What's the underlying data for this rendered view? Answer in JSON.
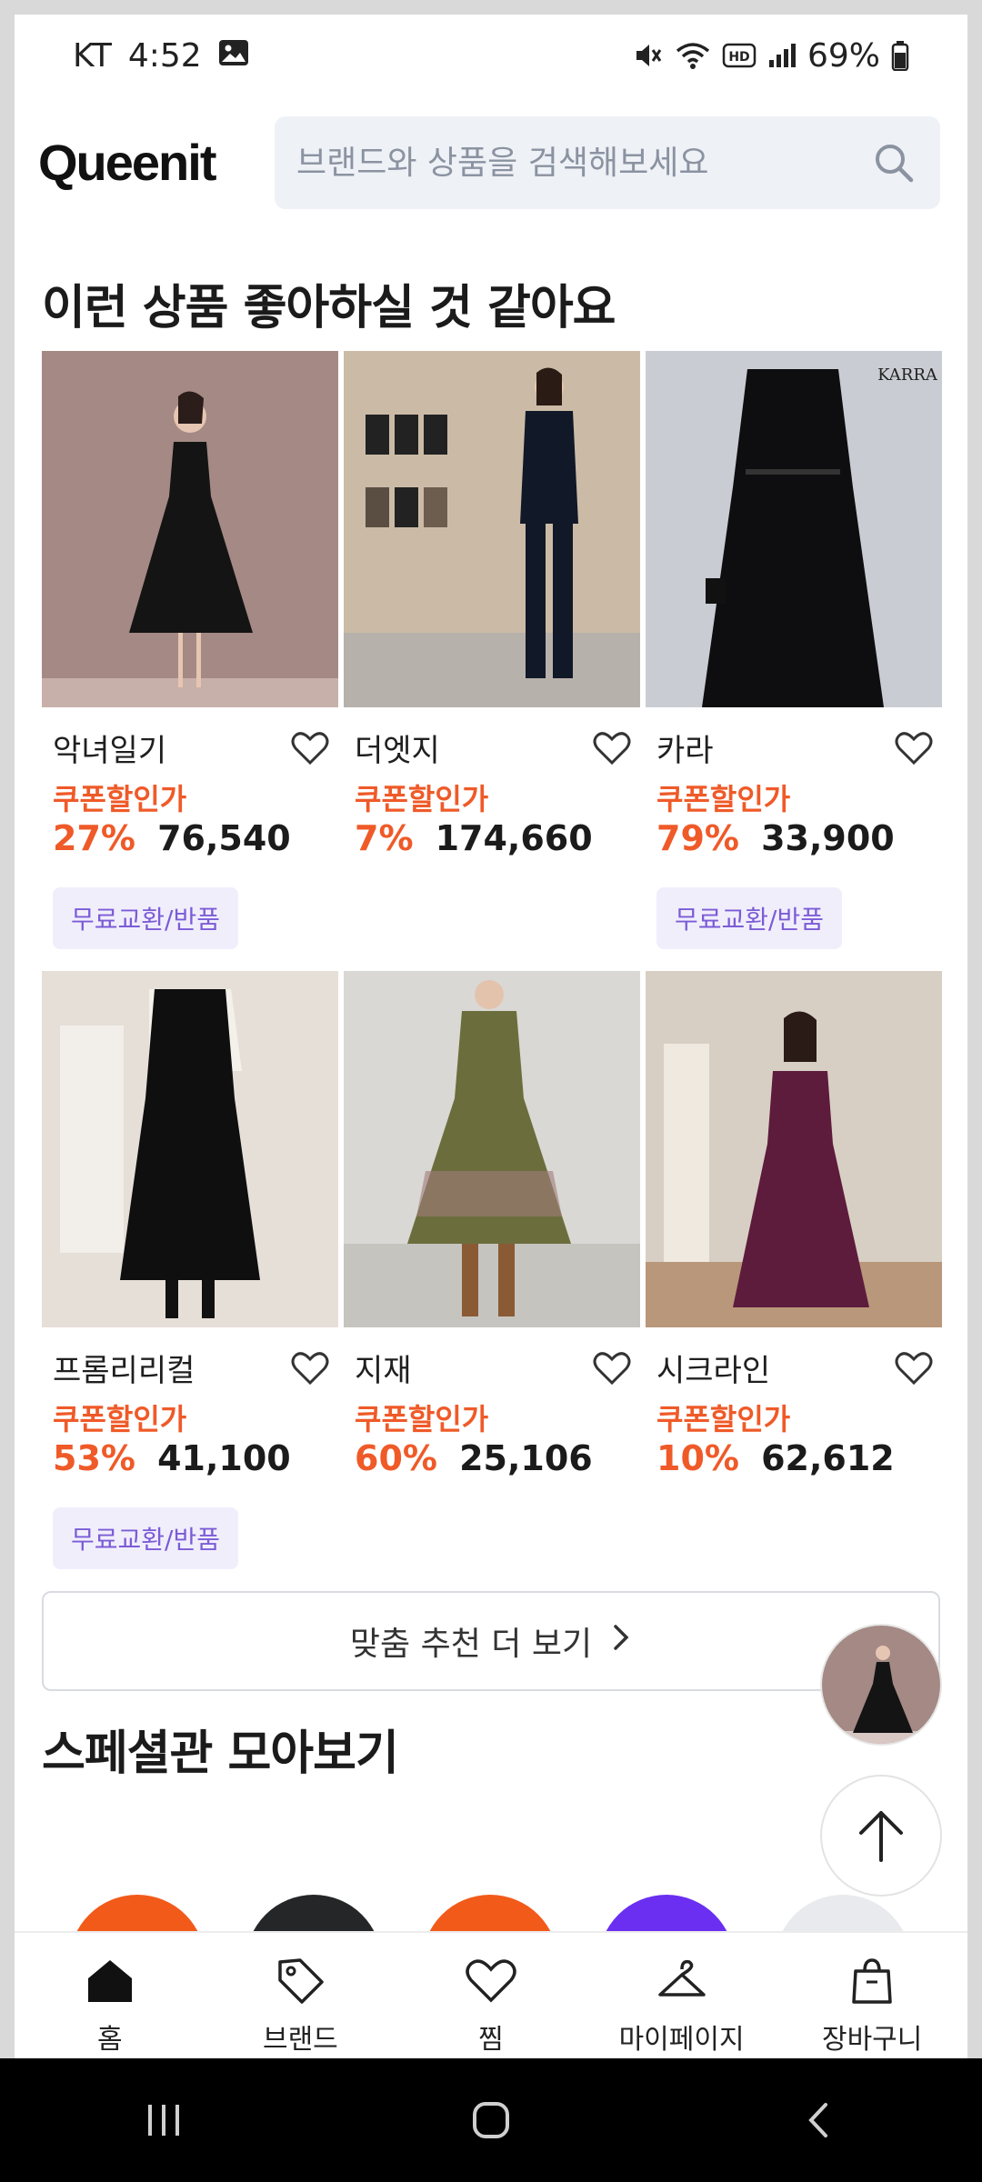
{
  "status_bar": {
    "carrier": "KT",
    "time": "4:52",
    "battery": "69%"
  },
  "header": {
    "logo": "Queenit",
    "search_placeholder": "브랜드와 상품을 검색해보세요"
  },
  "recommend": {
    "title": "이런 상품 좋아하실 것 같아요",
    "products": [
      {
        "brand": "악녀일기",
        "coupon": "쿠폰할인가",
        "discount": "27%",
        "price": "76,540",
        "tag": "무료교환/반품"
      },
      {
        "brand": "더엣지",
        "coupon": "쿠폰할인가",
        "discount": "7%",
        "price": "174,660",
        "tag": ""
      },
      {
        "brand": "카라",
        "coupon": "쿠폰할인가",
        "discount": "79%",
        "price": "33,900",
        "tag": "무료교환/반품"
      },
      {
        "brand": "프롬리리컬",
        "coupon": "쿠폰할인가",
        "discount": "53%",
        "price": "41,100",
        "tag": "무료교환/반품"
      },
      {
        "brand": "지재",
        "coupon": "쿠폰할인가",
        "discount": "60%",
        "price": "25,106",
        "tag": ""
      },
      {
        "brand": "시크라인",
        "coupon": "쿠폰할인가",
        "discount": "10%",
        "price": "62,612",
        "tag": ""
      }
    ],
    "more_button": "맞춤 추천 더 보기"
  },
  "special": {
    "title": "스페셜관 모아보기"
  },
  "bottom_nav": {
    "home": "홈",
    "brand": "브랜드",
    "wish": "찜",
    "mypage": "마이페이지",
    "cart": "장바구니"
  },
  "colors": {
    "accent_orange": "#ef5a28",
    "tag_purple": "#7b5cd6",
    "search_bg": "#eef1f6"
  }
}
